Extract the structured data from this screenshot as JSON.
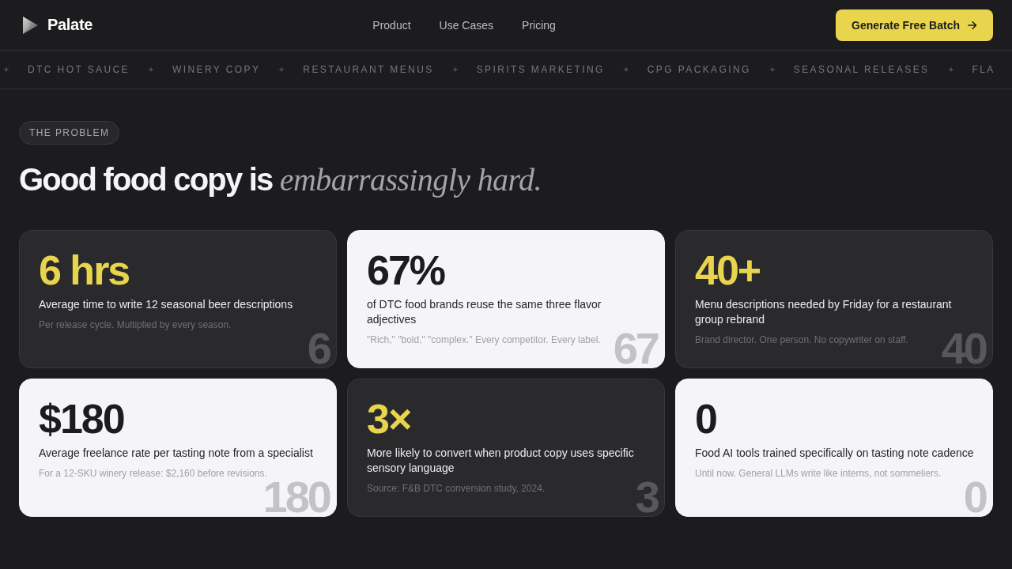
{
  "header": {
    "logo": {
      "name": "Palate"
    },
    "nav_links": [
      "Product",
      "Use Cases",
      "Pricing"
    ],
    "cta": {
      "label": "Generate Free Batch"
    }
  },
  "ticker": {
    "items": [
      "DTC HOT SAUCE",
      "WINERY COPY",
      "RESTAURANT MENUS",
      "SPIRITS MARKETING",
      "CPG PACKAGING",
      "SEASONAL RELEASES",
      "FLA"
    ]
  },
  "problem": {
    "badge": "THE PROBLEM",
    "heading": "Good food copy is *embarrassingly hard.*",
    "stats": [
      {
        "kind": "dark",
        "value": "6 hrs",
        "description": "Average time to write 12 seasonal beer descriptions",
        "note": "Per release cycle. Multiplied by every season.",
        "ghost": "6"
      },
      {
        "kind": "light",
        "value": "67%",
        "description": "of DTC food brands reuse the same three flavor adjectives",
        "note": "\"Rich,\" \"bold,\" \"complex.\" Every competitor. Every label.",
        "ghost": "67"
      },
      {
        "kind": "dark",
        "value": "40+",
        "description": "Menu descriptions needed by Friday for a restaurant group rebrand",
        "note": "Brand director. One person. No copywriter on staff.",
        "ghost": "40"
      },
      {
        "kind": "light",
        "value": "$180",
        "description": "Average freelance rate per tasting note from a specialist",
        "note": "For a 12-SKU winery release: $2,160 before revisions.",
        "ghost": "180"
      },
      {
        "kind": "dark",
        "value": "3×",
        "description": "More likely to convert when product copy uses specific sensory language",
        "note": "Source: F&B DTC conversion study, 2024.",
        "ghost": "3"
      },
      {
        "kind": "light",
        "value": "0",
        "description": "Food AI tools trained specifically on tasting note cadence",
        "note": "Until now. General LLMs write like interns, not sommeliers.",
        "ghost": "0"
      }
    ]
  }
}
